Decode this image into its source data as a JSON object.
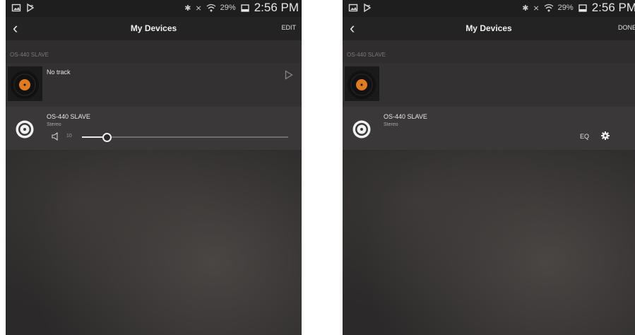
{
  "status_bar": {
    "battery": "29%",
    "time": "2:56 PM",
    "icons": [
      "image-icon",
      "media-icon",
      "bluetooth-icon",
      "mute-icon",
      "wifi-icon",
      "battery-icon"
    ]
  },
  "left_screen": {
    "title": "My Devices",
    "action_label": "EDIT",
    "section_label": "OS-440 SLAVE",
    "track_text": "No track",
    "device": {
      "name": "OS-440 SLAVE",
      "mode": "Stereo"
    },
    "volume": {
      "value": "10",
      "level_fraction": 0.12
    }
  },
  "right_screen": {
    "title": "My Devices",
    "action_label": "DONE",
    "section_label": "OS-440 SLAVE",
    "device": {
      "name": "OS-440 SLAVE",
      "mode": "Stereo"
    },
    "eq_label": "EQ"
  },
  "colors": {
    "background": "#2b2929",
    "accent": "#e8e8e8",
    "album_orange": "#e07a1f"
  }
}
